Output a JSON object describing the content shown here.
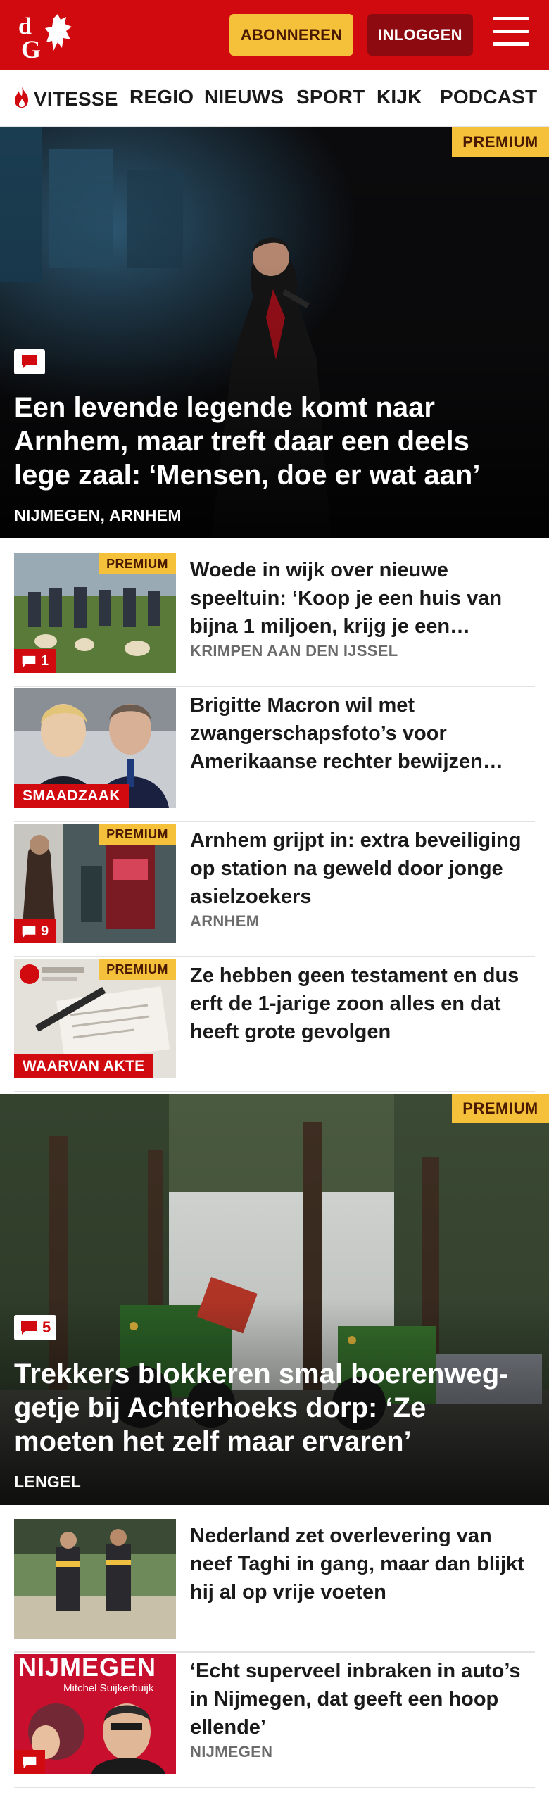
{
  "header": {
    "brand_letters": "dG",
    "subscribe_label": "ABONNEREN",
    "login_label": "INLOGGEN",
    "brand_color": "#d10a10",
    "accent_color": "#f6c13a"
  },
  "nav": {
    "items": [
      "VITESSE",
      "REGIO",
      "NIEUWS",
      "SPORT",
      "KIJK",
      "PODCAST"
    ]
  },
  "hero1": {
    "badge": "PREMIUM",
    "comment_icon": "speech-bubble-icon",
    "title": "Een levende legende komt naar Arnhem, maar treft daar een deels lege zaal: ‘Mensen, doe er wat aan’",
    "location": "NIJMEGEN, ARNHEM"
  },
  "items": [
    {
      "premium": "PREMIUM",
      "comments": "1",
      "title": "Woede in wijk over nieuwe speeltuin: ‘Koop je een huis van bijna 1 miljoen, krijg je een…",
      "location": "KRIMPEN AAN DEN IJSSEL"
    },
    {
      "label": "SMAADZAAK",
      "title": "Brigitte Macron wil met zwangerschapsfoto’s voor Amerikaanse rechter bewijzen…"
    },
    {
      "premium": "PREMIUM",
      "comments": "9",
      "title": "Arnhem grijpt in: extra beveili­ging op station na geweld door jonge asielzoekers",
      "location": "ARNHEM"
    },
    {
      "premium": "PREMIUM",
      "label": "WAARVAN AKTE",
      "title": "Ze hebben geen testament en dus erft de 1-jarige zoon alles en dat heeft grote gevolgen"
    }
  ],
  "hero2": {
    "badge": "PREMIUM",
    "comments": "5",
    "title": "Trekkers blokkeren smal boerenweg­getje bij Achterhoeks dorp: ‘Ze moeten het zelf maar ervaren’",
    "location": "LENGEL"
  },
  "items2": [
    {
      "title": "Nederland zet overlevering van neef Taghi in gang, maar dan blijkt hij al op vrije voeten"
    },
    {
      "thumb_text": "NIJMEGEN",
      "thumb_sub": "Mitchel Suijkerbuijk",
      "title": "‘Echt superveel inbraken in auto’s in Nijmegen, dat geeft een hoop ellende’",
      "location": "NIJMEGEN"
    }
  ]
}
